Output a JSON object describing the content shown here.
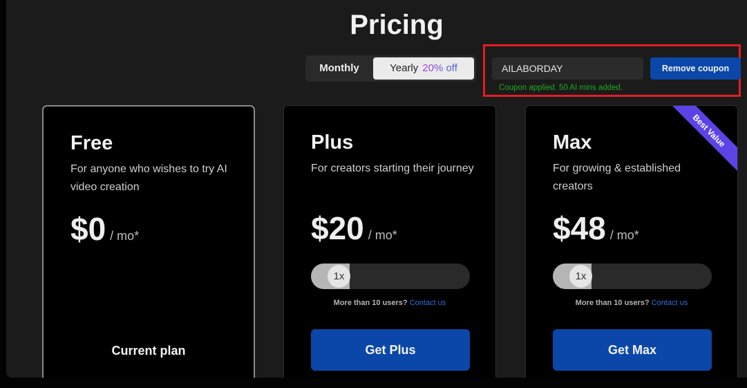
{
  "page": {
    "title": "Pricing"
  },
  "billing_toggle": {
    "monthly_label": "Monthly",
    "yearly_label": "Yearly",
    "yearly_discount": "20% off",
    "selected": "Monthly"
  },
  "coupon": {
    "value": "AILABORDAY",
    "remove_label": "Remove coupon",
    "message": "Coupon applied. 50 AI mins added.",
    "message_color": "#1eaa1e",
    "highlight_color": "#e11d24"
  },
  "plans": [
    {
      "name": "Free",
      "description": "For anyone who wishes to try AI video creation",
      "price": "$0",
      "per": "/ mo*",
      "action_label": "Current plan",
      "is_current": true
    },
    {
      "name": "Plus",
      "description": "For creators starting their journey",
      "price": "$20",
      "per": "/ mo*",
      "multiplier": "1x",
      "contact_prompt": "More than 10 users?",
      "contact_link": "Contact us",
      "action_label": "Get Plus"
    },
    {
      "name": "Max",
      "description": "For growing & established creators",
      "price": "$48",
      "per": "/ mo*",
      "multiplier": "1x",
      "contact_prompt": "More than 10 users?",
      "contact_link": "Contact us",
      "action_label": "Get Max",
      "badge": "Best Value"
    }
  ],
  "colors": {
    "accent": "#0b47a8",
    "badge": "#5b44e6",
    "link": "#2f6fe0"
  }
}
